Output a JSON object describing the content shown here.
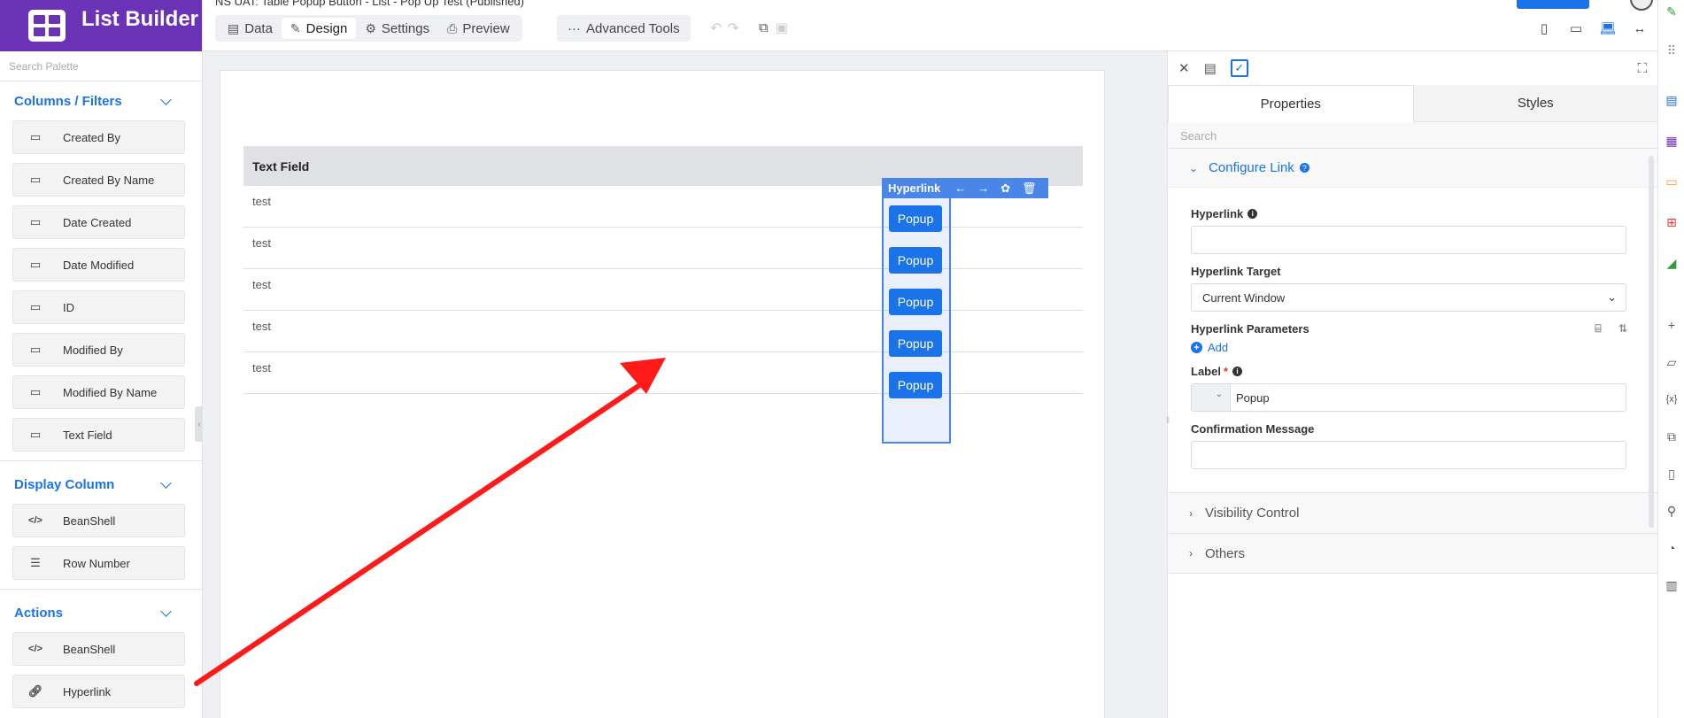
{
  "app": {
    "title": "List Builder",
    "breadcrumb": "NS UAT: Table Popup Button - List - Pop Up Test (Published)"
  },
  "palette": {
    "search_placeholder": "Search Palette",
    "sections": [
      {
        "title": "Columns / Filters",
        "items": [
          {
            "label": "Created By",
            "icon": "drive-icon"
          },
          {
            "label": "Created By Name",
            "icon": "drive-icon"
          },
          {
            "label": "Date Created",
            "icon": "drive-icon"
          },
          {
            "label": "Date Modified",
            "icon": "drive-icon"
          },
          {
            "label": "ID",
            "icon": "drive-icon"
          },
          {
            "label": "Modified By",
            "icon": "drive-icon"
          },
          {
            "label": "Modified By Name",
            "icon": "drive-icon"
          },
          {
            "label": "Text Field",
            "icon": "drive-icon"
          }
        ]
      },
      {
        "title": "Display Column",
        "items": [
          {
            "label": "BeanShell",
            "icon": "code-icon"
          },
          {
            "label": "Row Number",
            "icon": "list-number-icon"
          }
        ]
      },
      {
        "title": "Actions",
        "items": [
          {
            "label": "BeanShell",
            "icon": "code-icon"
          },
          {
            "label": "Hyperlink",
            "icon": "link-icon"
          }
        ]
      }
    ]
  },
  "toolbar": {
    "tabs": [
      {
        "label": "Data",
        "icon": "data-icon"
      },
      {
        "label": "Design",
        "icon": "design-icon",
        "active": true
      },
      {
        "label": "Settings",
        "icon": "gear-icon"
      },
      {
        "label": "Preview",
        "icon": "preview-icon"
      }
    ],
    "advanced_tools": "Advanced Tools"
  },
  "canvas": {
    "table_header": "Text Field",
    "rows": [
      {
        "text": "test",
        "button": "Popup"
      },
      {
        "text": "test",
        "button": "Popup"
      },
      {
        "text": "test",
        "button": "Popup"
      },
      {
        "text": "test",
        "button": "Popup"
      },
      {
        "text": "test",
        "button": "Popup"
      }
    ],
    "column_label": "Hyperlink"
  },
  "properties": {
    "tabs": [
      "Properties",
      "Styles"
    ],
    "search_placeholder": "Search",
    "group_title": "Configure Link",
    "fields": {
      "hyperlink_label": "Hyperlink",
      "hyperlink_value": "",
      "target_label": "Hyperlink Target",
      "target_value": "Current Window",
      "params_label": "Hyperlink Parameters",
      "add_label": "Add",
      "label_label": "Label",
      "label_value": "Popup",
      "confirm_label": "Confirmation Message",
      "confirm_value": ""
    },
    "collapsed_groups": [
      "Visibility Control",
      "Others"
    ]
  },
  "colors": {
    "brand": "#6a32b4",
    "accent": "#1a73e8",
    "annotation_arrow": "#ff1a1a"
  }
}
